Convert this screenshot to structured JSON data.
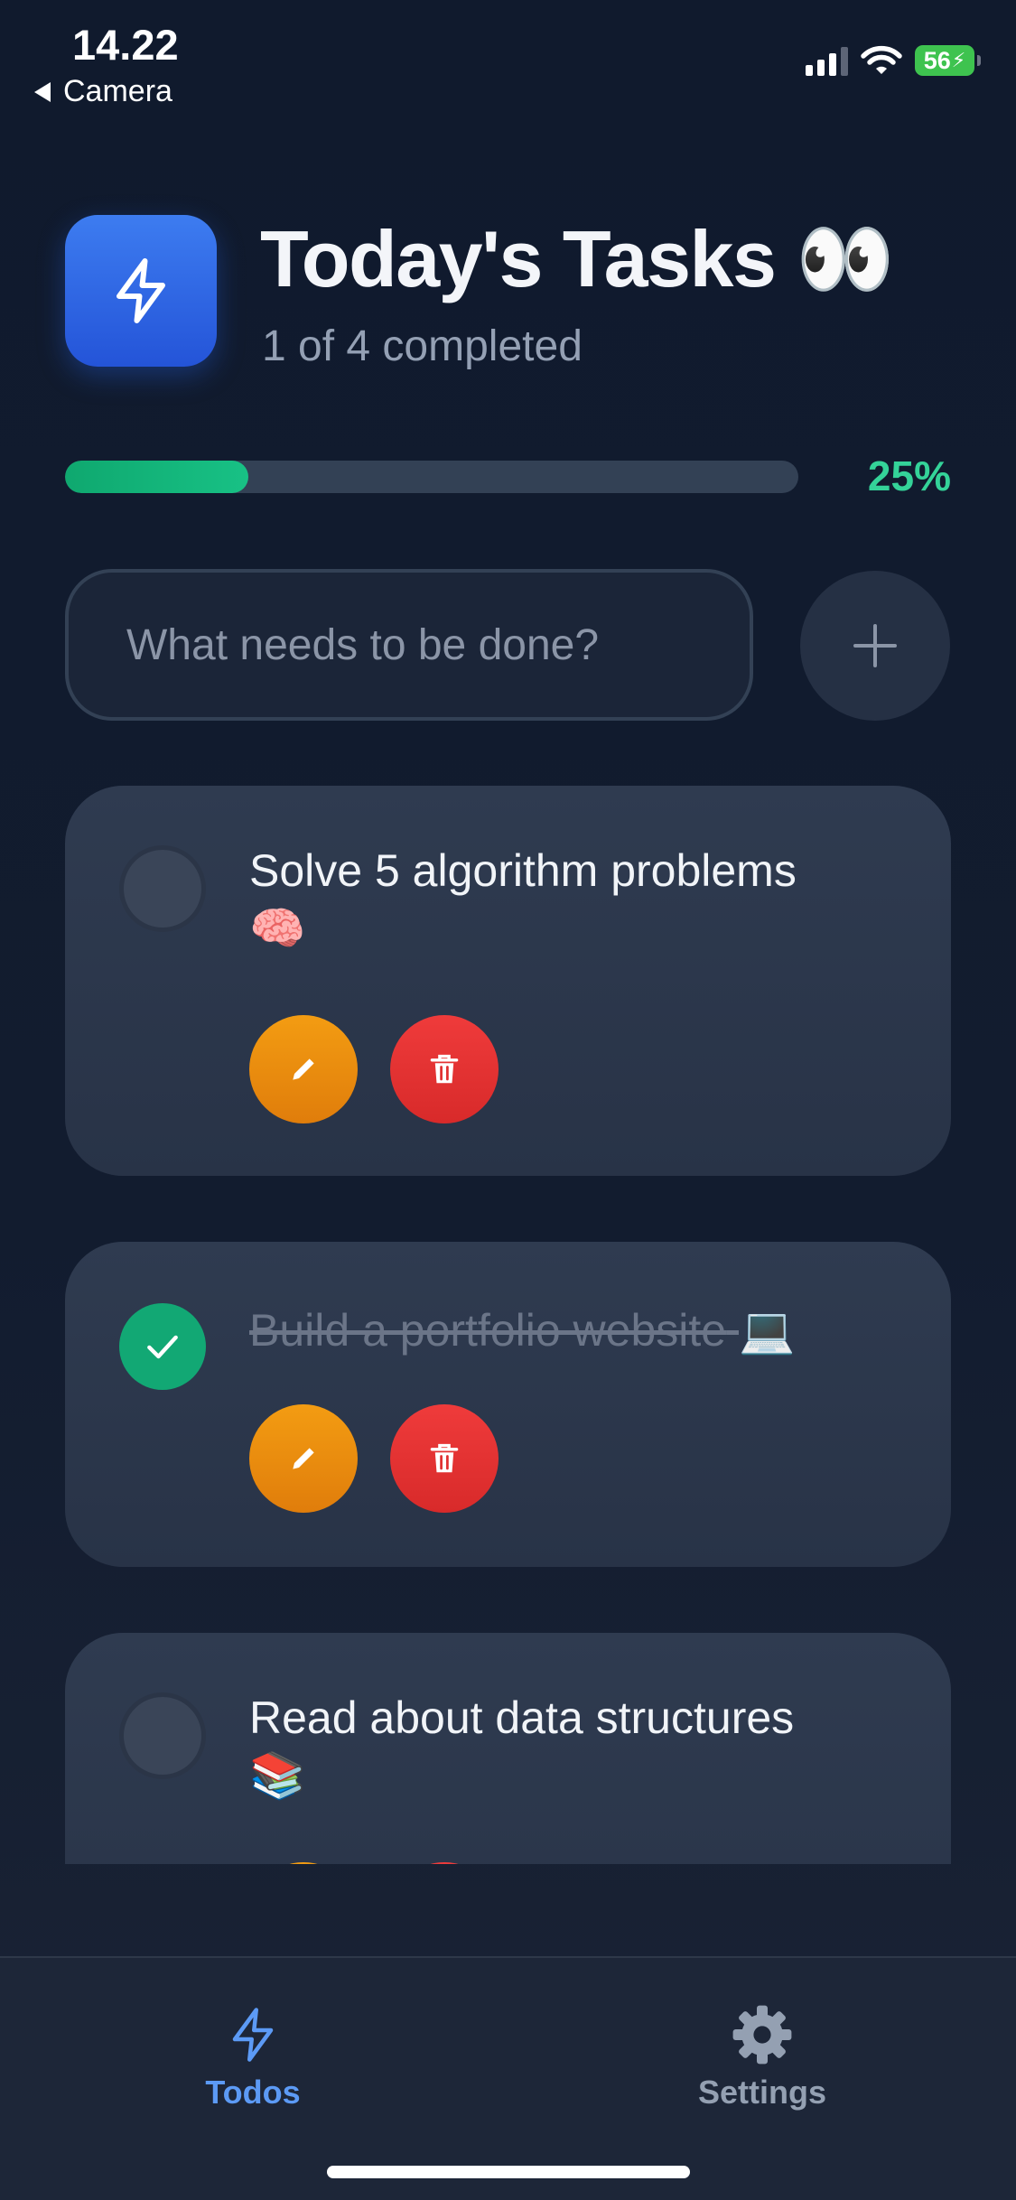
{
  "status_bar": {
    "time": "14.22",
    "back_label": "Camera",
    "battery_level": "56"
  },
  "header": {
    "title": "Today's Tasks 👀",
    "subtitle": "1 of 4 completed",
    "icon": "lightning-bolt-icon",
    "accent_color": "#2f6bea"
  },
  "progress": {
    "percent_label": "25%",
    "fraction": 0.25,
    "color": "#10b981"
  },
  "new_task": {
    "placeholder": "What needs to be done?",
    "value": "",
    "add_icon": "plus-icon"
  },
  "tasks": [
    {
      "text": "Solve 5 algorithm problems",
      "emoji": "🧠",
      "completed": false
    },
    {
      "text": "Build a portfolio website",
      "emoji": "💻",
      "completed": true
    },
    {
      "text": "Read about data structures",
      "emoji": "📚",
      "completed": false
    }
  ],
  "task_actions": {
    "edit_icon": "pencil-icon",
    "delete_icon": "trash-icon",
    "edit_color": "#f29a12",
    "delete_color": "#e53535"
  },
  "tab_bar": {
    "tabs": [
      {
        "label": "Todos",
        "icon": "lightning-bolt-icon",
        "active": true
      },
      {
        "label": "Settings",
        "icon": "gear-icon",
        "active": false
      }
    ],
    "active_color": "#5c9af5"
  }
}
